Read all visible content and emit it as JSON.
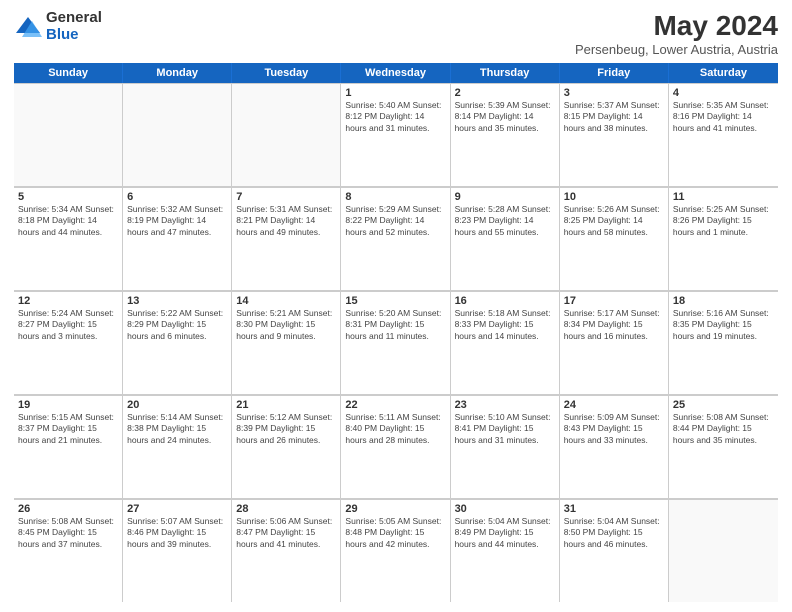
{
  "logo": {
    "general": "General",
    "blue": "Blue"
  },
  "header": {
    "title": "May 2024",
    "subtitle": "Persenbeug, Lower Austria, Austria"
  },
  "days_of_week": [
    "Sunday",
    "Monday",
    "Tuesday",
    "Wednesday",
    "Thursday",
    "Friday",
    "Saturday"
  ],
  "weeks": [
    [
      {
        "day": "",
        "info": ""
      },
      {
        "day": "",
        "info": ""
      },
      {
        "day": "",
        "info": ""
      },
      {
        "day": "1",
        "info": "Sunrise: 5:40 AM\nSunset: 8:12 PM\nDaylight: 14 hours\nand 31 minutes."
      },
      {
        "day": "2",
        "info": "Sunrise: 5:39 AM\nSunset: 8:14 PM\nDaylight: 14 hours\nand 35 minutes."
      },
      {
        "day": "3",
        "info": "Sunrise: 5:37 AM\nSunset: 8:15 PM\nDaylight: 14 hours\nand 38 minutes."
      },
      {
        "day": "4",
        "info": "Sunrise: 5:35 AM\nSunset: 8:16 PM\nDaylight: 14 hours\nand 41 minutes."
      }
    ],
    [
      {
        "day": "5",
        "info": "Sunrise: 5:34 AM\nSunset: 8:18 PM\nDaylight: 14 hours\nand 44 minutes."
      },
      {
        "day": "6",
        "info": "Sunrise: 5:32 AM\nSunset: 8:19 PM\nDaylight: 14 hours\nand 47 minutes."
      },
      {
        "day": "7",
        "info": "Sunrise: 5:31 AM\nSunset: 8:21 PM\nDaylight: 14 hours\nand 49 minutes."
      },
      {
        "day": "8",
        "info": "Sunrise: 5:29 AM\nSunset: 8:22 PM\nDaylight: 14 hours\nand 52 minutes."
      },
      {
        "day": "9",
        "info": "Sunrise: 5:28 AM\nSunset: 8:23 PM\nDaylight: 14 hours\nand 55 minutes."
      },
      {
        "day": "10",
        "info": "Sunrise: 5:26 AM\nSunset: 8:25 PM\nDaylight: 14 hours\nand 58 minutes."
      },
      {
        "day": "11",
        "info": "Sunrise: 5:25 AM\nSunset: 8:26 PM\nDaylight: 15 hours\nand 1 minute."
      }
    ],
    [
      {
        "day": "12",
        "info": "Sunrise: 5:24 AM\nSunset: 8:27 PM\nDaylight: 15 hours\nand 3 minutes."
      },
      {
        "day": "13",
        "info": "Sunrise: 5:22 AM\nSunset: 8:29 PM\nDaylight: 15 hours\nand 6 minutes."
      },
      {
        "day": "14",
        "info": "Sunrise: 5:21 AM\nSunset: 8:30 PM\nDaylight: 15 hours\nand 9 minutes."
      },
      {
        "day": "15",
        "info": "Sunrise: 5:20 AM\nSunset: 8:31 PM\nDaylight: 15 hours\nand 11 minutes."
      },
      {
        "day": "16",
        "info": "Sunrise: 5:18 AM\nSunset: 8:33 PM\nDaylight: 15 hours\nand 14 minutes."
      },
      {
        "day": "17",
        "info": "Sunrise: 5:17 AM\nSunset: 8:34 PM\nDaylight: 15 hours\nand 16 minutes."
      },
      {
        "day": "18",
        "info": "Sunrise: 5:16 AM\nSunset: 8:35 PM\nDaylight: 15 hours\nand 19 minutes."
      }
    ],
    [
      {
        "day": "19",
        "info": "Sunrise: 5:15 AM\nSunset: 8:37 PM\nDaylight: 15 hours\nand 21 minutes."
      },
      {
        "day": "20",
        "info": "Sunrise: 5:14 AM\nSunset: 8:38 PM\nDaylight: 15 hours\nand 24 minutes."
      },
      {
        "day": "21",
        "info": "Sunrise: 5:12 AM\nSunset: 8:39 PM\nDaylight: 15 hours\nand 26 minutes."
      },
      {
        "day": "22",
        "info": "Sunrise: 5:11 AM\nSunset: 8:40 PM\nDaylight: 15 hours\nand 28 minutes."
      },
      {
        "day": "23",
        "info": "Sunrise: 5:10 AM\nSunset: 8:41 PM\nDaylight: 15 hours\nand 31 minutes."
      },
      {
        "day": "24",
        "info": "Sunrise: 5:09 AM\nSunset: 8:43 PM\nDaylight: 15 hours\nand 33 minutes."
      },
      {
        "day": "25",
        "info": "Sunrise: 5:08 AM\nSunset: 8:44 PM\nDaylight: 15 hours\nand 35 minutes."
      }
    ],
    [
      {
        "day": "26",
        "info": "Sunrise: 5:08 AM\nSunset: 8:45 PM\nDaylight: 15 hours\nand 37 minutes."
      },
      {
        "day": "27",
        "info": "Sunrise: 5:07 AM\nSunset: 8:46 PM\nDaylight: 15 hours\nand 39 minutes."
      },
      {
        "day": "28",
        "info": "Sunrise: 5:06 AM\nSunset: 8:47 PM\nDaylight: 15 hours\nand 41 minutes."
      },
      {
        "day": "29",
        "info": "Sunrise: 5:05 AM\nSunset: 8:48 PM\nDaylight: 15 hours\nand 42 minutes."
      },
      {
        "day": "30",
        "info": "Sunrise: 5:04 AM\nSunset: 8:49 PM\nDaylight: 15 hours\nand 44 minutes."
      },
      {
        "day": "31",
        "info": "Sunrise: 5:04 AM\nSunset: 8:50 PM\nDaylight: 15 hours\nand 46 minutes."
      },
      {
        "day": "",
        "info": ""
      }
    ]
  ]
}
